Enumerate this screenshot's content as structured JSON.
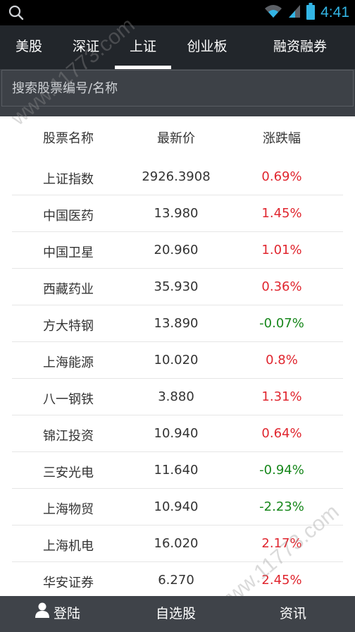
{
  "status_bar": {
    "time": "4:41"
  },
  "tabs": [
    {
      "label": "美股",
      "active": false
    },
    {
      "label": "深证",
      "active": false
    },
    {
      "label": "上证",
      "active": true
    },
    {
      "label": "创业板",
      "active": false
    },
    {
      "label": "融资融券",
      "active": false
    }
  ],
  "search": {
    "placeholder": "搜索股票编号/名称"
  },
  "table": {
    "headers": [
      "股票名称",
      "最新价",
      "涨跌幅"
    ],
    "rows": [
      {
        "name": "上证指数",
        "price": "2926.3908",
        "change": "0.69%",
        "dir": "up"
      },
      {
        "name": "中国医药",
        "price": "13.980",
        "change": "1.45%",
        "dir": "up"
      },
      {
        "name": "中国卫星",
        "price": "20.960",
        "change": "1.01%",
        "dir": "up"
      },
      {
        "name": "西藏药业",
        "price": "35.930",
        "change": "0.36%",
        "dir": "up"
      },
      {
        "name": "方大特钢",
        "price": "13.890",
        "change": "-0.07%",
        "dir": "down"
      },
      {
        "name": "上海能源",
        "price": "10.020",
        "change": "0.8%",
        "dir": "up"
      },
      {
        "name": "八一钢铁",
        "price": "3.880",
        "change": "1.31%",
        "dir": "up"
      },
      {
        "name": "锦江投资",
        "price": "10.940",
        "change": "0.64%",
        "dir": "up"
      },
      {
        "name": "三安光电",
        "price": "11.640",
        "change": "-0.94%",
        "dir": "down"
      },
      {
        "name": "上海物贸",
        "price": "10.940",
        "change": "-2.23%",
        "dir": "down"
      },
      {
        "name": "上海机电",
        "price": "16.020",
        "change": "2.17%",
        "dir": "up"
      },
      {
        "name": "华安证券",
        "price": "6.270",
        "change": "2.45%",
        "dir": "up"
      }
    ]
  },
  "colors": {
    "up": "#e0262f",
    "down": "#17871b",
    "accent": "#33b5e5"
  },
  "watermark": "www.11773.com",
  "bottom_nav": {
    "login": "登陆",
    "watchlist": "自选股",
    "news": "资讯"
  }
}
